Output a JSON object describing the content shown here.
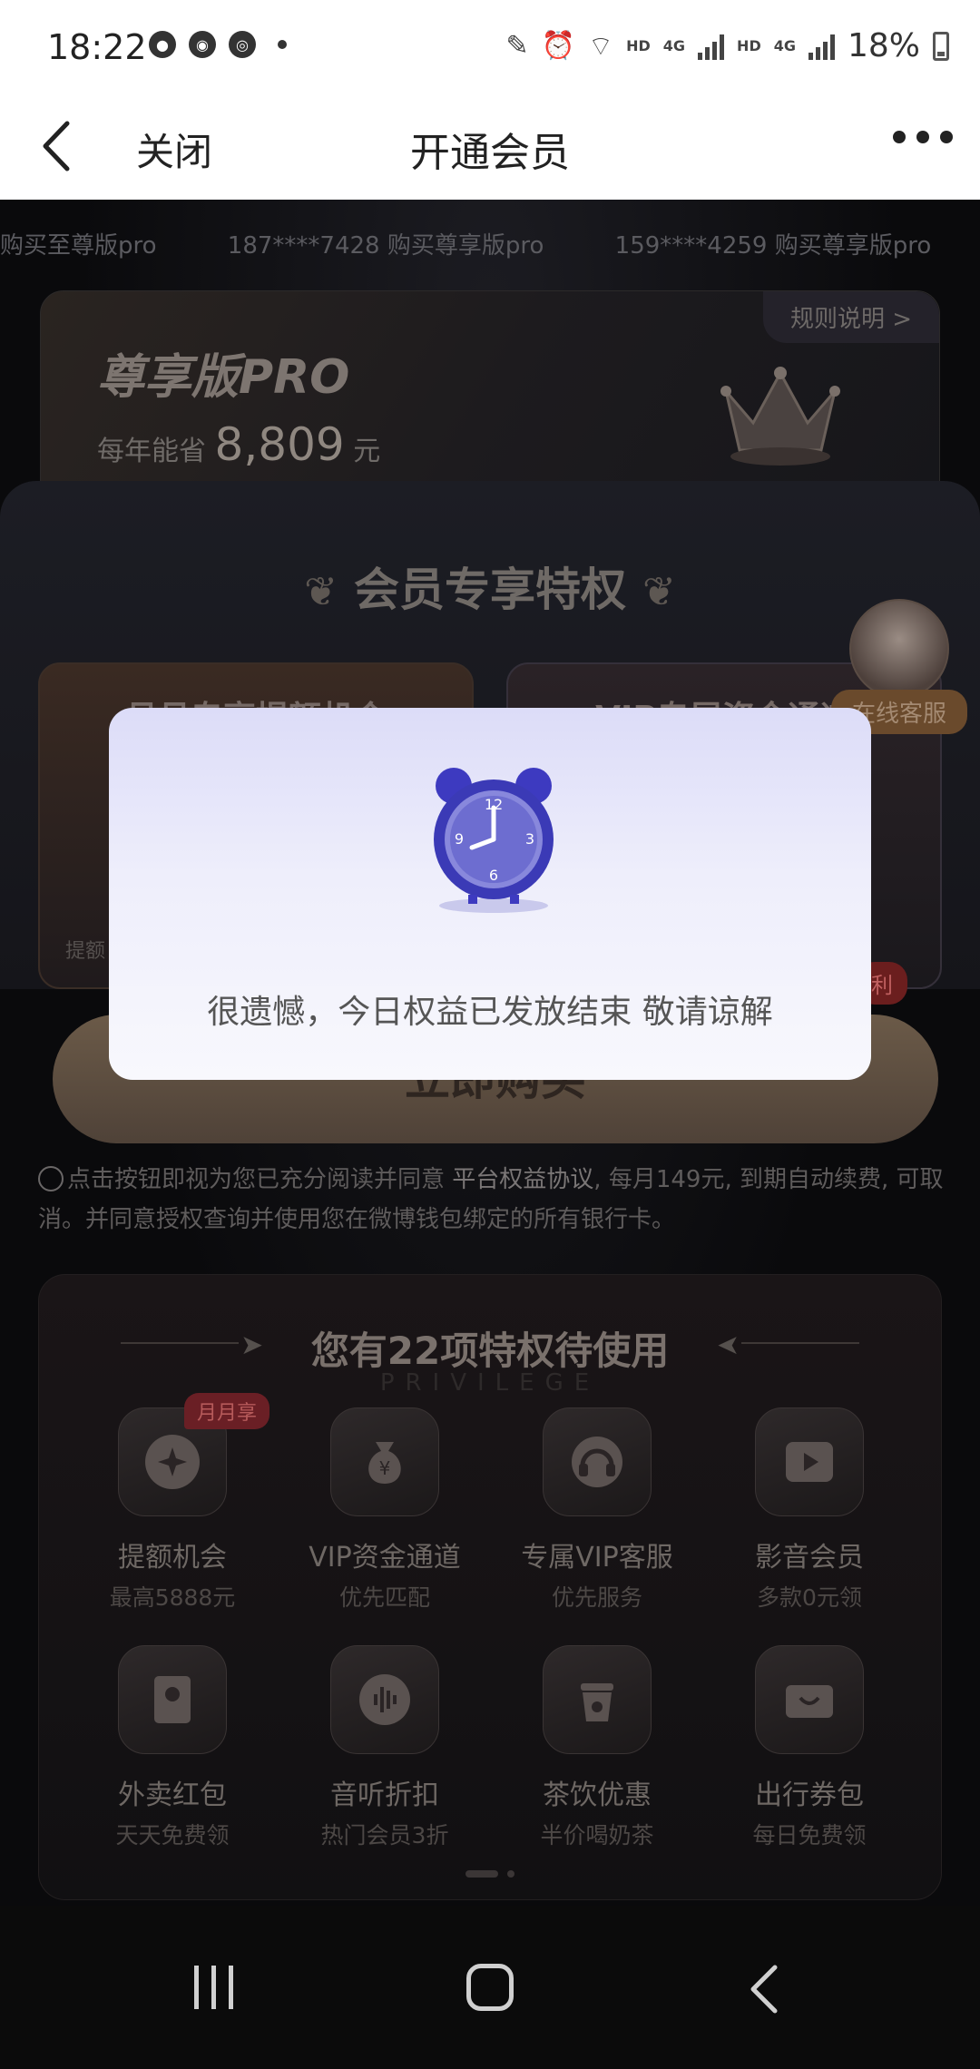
{
  "status_bar": {
    "time": "18:22",
    "battery": "18%",
    "icons": [
      "profile-icon",
      "weibo-icon",
      "wechat-icon",
      "dot-icon",
      "pen-icon",
      "alarm-icon",
      "wifi-icon",
      "hd-4g-signal-icon",
      "hd-4g-signal-icon",
      "battery-icon"
    ],
    "hd1": "HD",
    "net1": "4G",
    "hd2": "HD",
    "net2": "4G"
  },
  "nav": {
    "close_label": "关闭",
    "title": "开通会员"
  },
  "ticker": {
    "items": [
      "购买至尊版pro",
      "187****7428 购买尊享版pro",
      "159****4259 购买尊享版pro"
    ]
  },
  "pro_card": {
    "rules_label": "规则说明 >",
    "title": "尊享版PRO",
    "save_prefix": "每年能省",
    "save_amount": "8,809",
    "save_unit": "元"
  },
  "privileges": {
    "heading": "会员专享特权",
    "left_box_title": "月月专享提额机会",
    "left_box_note": "提额",
    "right_box_title": "VIP专属资金通道"
  },
  "customer_service": {
    "label": "在线客服"
  },
  "buy": {
    "label": "立即购买",
    "tag": "利"
  },
  "agreement": {
    "prefix": "点击按钮即视为您已充分阅读并同意",
    "link": "平台权益协议",
    "suffix": ", 每月149元, 到期自动续费, 可取消。并同意授权查询并使用您在微博钱包绑定的所有银行卡。"
  },
  "privilege_list": {
    "heading": "您有22项特权待使用",
    "subheading": "PRIVILEGE",
    "items": [
      {
        "name": "提额机会",
        "sub": "最高5888元",
        "icon": "quota-boost-icon",
        "badge": "月月享"
      },
      {
        "name": "VIP资金通道",
        "sub": "优先匹配",
        "icon": "money-bag-icon"
      },
      {
        "name": "专属VIP客服",
        "sub": "优先服务",
        "icon": "headset-icon"
      },
      {
        "name": "影音会员",
        "sub": "多款0元领",
        "icon": "video-icon"
      },
      {
        "name": "外卖红包",
        "sub": "天天免费领",
        "icon": "red-envelope-icon"
      },
      {
        "name": "音听折扣",
        "sub": "热门会员3折",
        "icon": "audio-wave-icon"
      },
      {
        "name": "茶饮优惠",
        "sub": "半价喝奶茶",
        "icon": "drink-cup-icon"
      },
      {
        "name": "出行券包",
        "sub": "每日免费领",
        "icon": "travel-voucher-icon"
      }
    ]
  },
  "dialog": {
    "icon": "alarm-clock-icon",
    "message": "很遗憾，今日权益已发放结束 敬请谅解"
  },
  "colors": {
    "dialog_top": "#dcdcf8",
    "background": "#0c0c0e",
    "gold_text": "#7a716c"
  }
}
